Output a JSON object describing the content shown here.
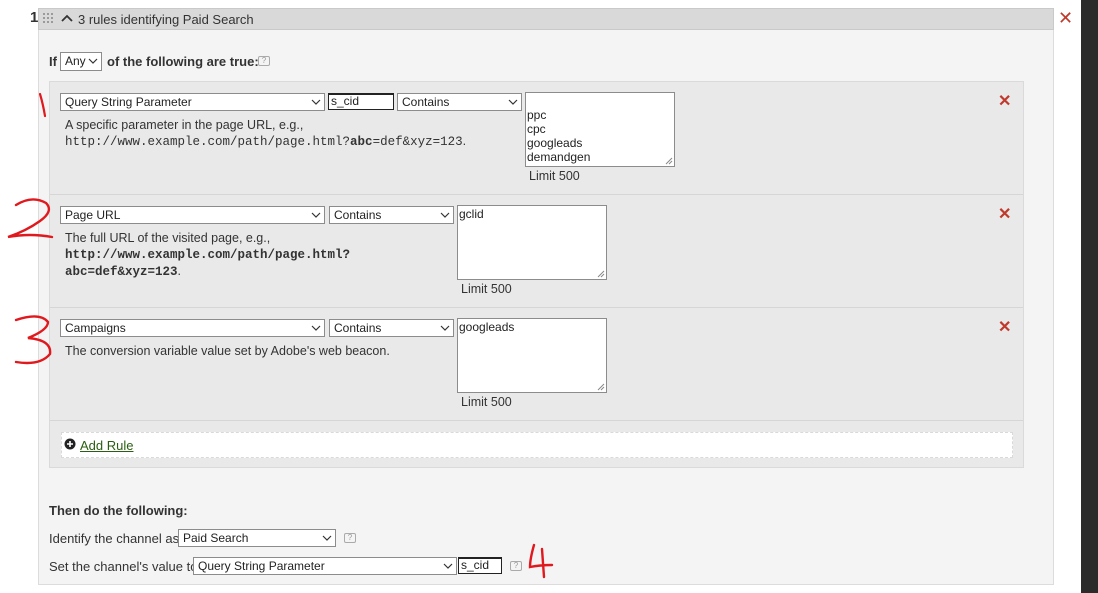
{
  "header": {
    "rule_number": "1",
    "title_prefix": "3 rules identifying ",
    "title_channel": "Paid Search"
  },
  "if_row": {
    "if_label": "If",
    "match_value": "Any",
    "suffix": "of the following are true:",
    "help_icon": "?"
  },
  "conditions": [
    {
      "dimension": "Query String Parameter",
      "parameter": "s_cid",
      "operator": "Contains",
      "values": "ppc\ncpc\ngoogleads\ndemandgen",
      "limit": "Limit 500",
      "desc_text": "A specific parameter in the page URL, e.g.,",
      "desc_url_a": "http://www.example.com/path/page.html?",
      "desc_url_b": "abc",
      "desc_url_c": "=def&xyz=123",
      "desc_url_d": "."
    },
    {
      "dimension": "Page URL",
      "operator": "Contains",
      "values": "gclid",
      "limit": "Limit 500",
      "desc_text": "The full URL of the visited page, e.g.,",
      "desc_url_line1": "http://www.example.com/path/page.html?",
      "desc_url_line2": "abc=def&xyz=123",
      "desc_end": "."
    },
    {
      "dimension": "Campaigns",
      "operator": "Contains",
      "values": "googleads",
      "limit": "Limit 500",
      "desc_text": "The conversion variable value set by Adobe's web beacon."
    }
  ],
  "add_rule": "Add Rule",
  "then": {
    "title": "Then do the following:",
    "identify_label": "Identify the channel as",
    "identify_value": "Paid Search",
    "set_label": "Set the channel's value to",
    "set_value": "Query String Parameter",
    "set_param": "s_cid"
  },
  "icons": {
    "remove": "close-icon",
    "grip": "drag-handle-icon",
    "collapse": "chevron-up-icon",
    "dropdown": "chevron-down-icon",
    "help": "help-icon",
    "add": "plus-circle-icon"
  },
  "colors": {
    "remove_red": "#c0392b",
    "link_green": "#2a5e10",
    "annotation_red": "#e0191e"
  }
}
